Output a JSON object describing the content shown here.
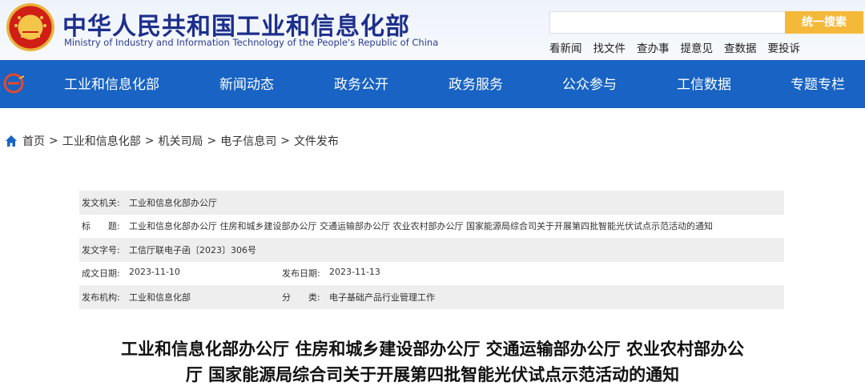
{
  "header": {
    "title": "中华人民共和国工业和信息化部",
    "subtitle": "Ministry of Industry and Information Technology of the People's Republic of China",
    "search_placeholder": "",
    "search_button": "统一搜索",
    "quick_links": [
      "看新闻",
      "找文件",
      "查办事",
      "提意见",
      "查数据",
      "要投诉"
    ]
  },
  "nav": {
    "items": [
      "工业和信息化部",
      "新闻动态",
      "政务公开",
      "政务服务",
      "公众参与",
      "工信数据",
      "专题专栏"
    ]
  },
  "breadcrumb": {
    "items": [
      "首页",
      "工业和信息化部",
      "机关司局",
      "电子信息司",
      "文件发布"
    ],
    "separator": ">"
  },
  "doc_info": {
    "issuer_label": "发文机关:",
    "issuer": "工业和信息化部办公厅",
    "title_label": "标　　题:",
    "title": "工业和信息化部办公厅 住房和城乡建设部办公厅 交通运输部办公厅 农业农村部办公厅 国家能源局综合司关于开展第四批智能光伏试点示范活动的通知",
    "number_label": "发文字号:",
    "number": "工信厅联电子函〔2023〕306号",
    "written_date_label": "成文日期:",
    "written_date": "2023-11-10",
    "publish_date_label": "发布日期:",
    "publish_date": "2023-11-13",
    "org_label": "发布机构:",
    "org": "工业和信息化部",
    "category_label": "分　　类:",
    "category": "电子基础产品行业管理工作"
  },
  "article": {
    "title_line1": "工业和信息化部办公厅 住房和城乡建设部办公厅 交通运输部办公厅 农业农村部办公",
    "title_line2": "厅 国家能源局综合司关于开展第四批智能光伏试点示范活动的通知"
  },
  "colors": {
    "nav_bg": "#1863c3",
    "title_blue": "#1d2f8c",
    "search_btn": "#f5b93a",
    "row_shade": "#eeeeee"
  }
}
